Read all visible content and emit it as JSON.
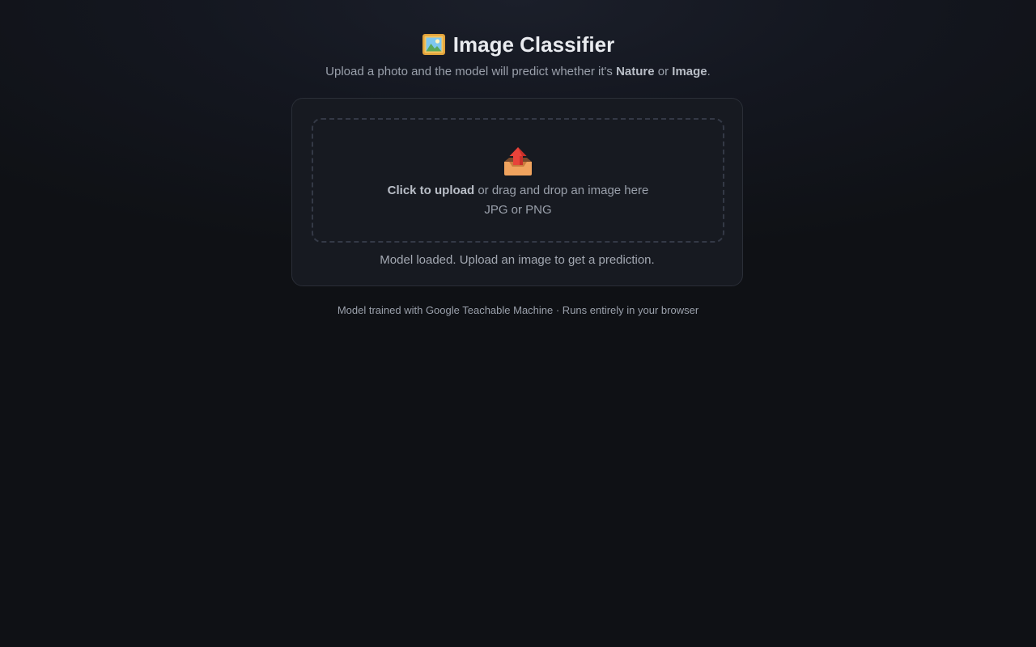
{
  "header": {
    "title_icon": "framed-picture-icon",
    "title": "Image Classifier",
    "subtitle_prefix": "Upload a photo and the model will predict whether it's ",
    "class_a": "Nature",
    "subtitle_mid": " or ",
    "class_b": "Image",
    "subtitle_suffix": "."
  },
  "upload": {
    "icon": "outbox-tray-icon",
    "action_label": "Click to upload",
    "drop_hint": " or drag and drop an image here",
    "formats": "JPG or PNG"
  },
  "status": {
    "message": "Model loaded. Upload an image to get a prediction."
  },
  "footer": {
    "text": "Model trained with Google Teachable Machine · Runs entirely in your browser"
  },
  "colors": {
    "background": "#0f1115",
    "card": "#171a21",
    "card_border": "#2a2e37",
    "dashed_border": "#343946",
    "muted_text": "#9aa0ab",
    "title_text": "#e9ebef"
  }
}
